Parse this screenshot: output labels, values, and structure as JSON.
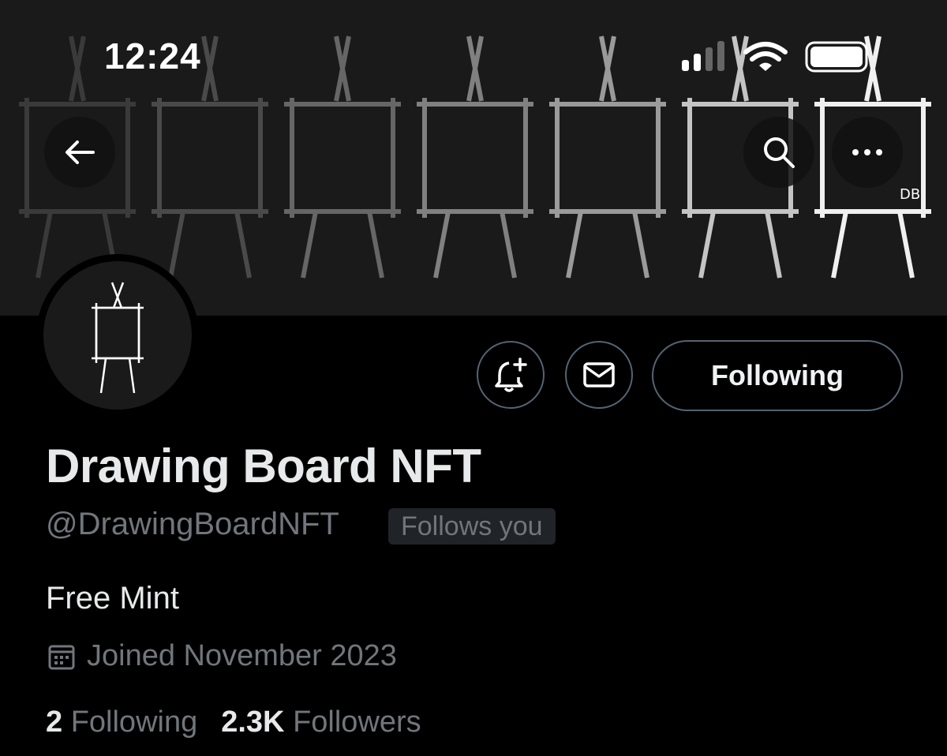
{
  "status_bar": {
    "time": "12:24"
  },
  "banner": {
    "watermark": "DB"
  },
  "profile": {
    "name": "Drawing Board NFT",
    "handle": "@DrawingBoardNFT",
    "follows_you": "Follows you",
    "bio": "Free Mint",
    "joined": "Joined November 2023",
    "following_count": "2",
    "following_label": "Following",
    "followers_count": "2.3K",
    "followers_label": "Followers"
  },
  "actions": {
    "follow_state": "Following"
  },
  "icons": {
    "back": "back-arrow-icon",
    "search": "search-icon",
    "more": "more-icon",
    "notify": "notification-bell-add-icon",
    "message": "envelope-icon",
    "calendar": "calendar-icon"
  }
}
